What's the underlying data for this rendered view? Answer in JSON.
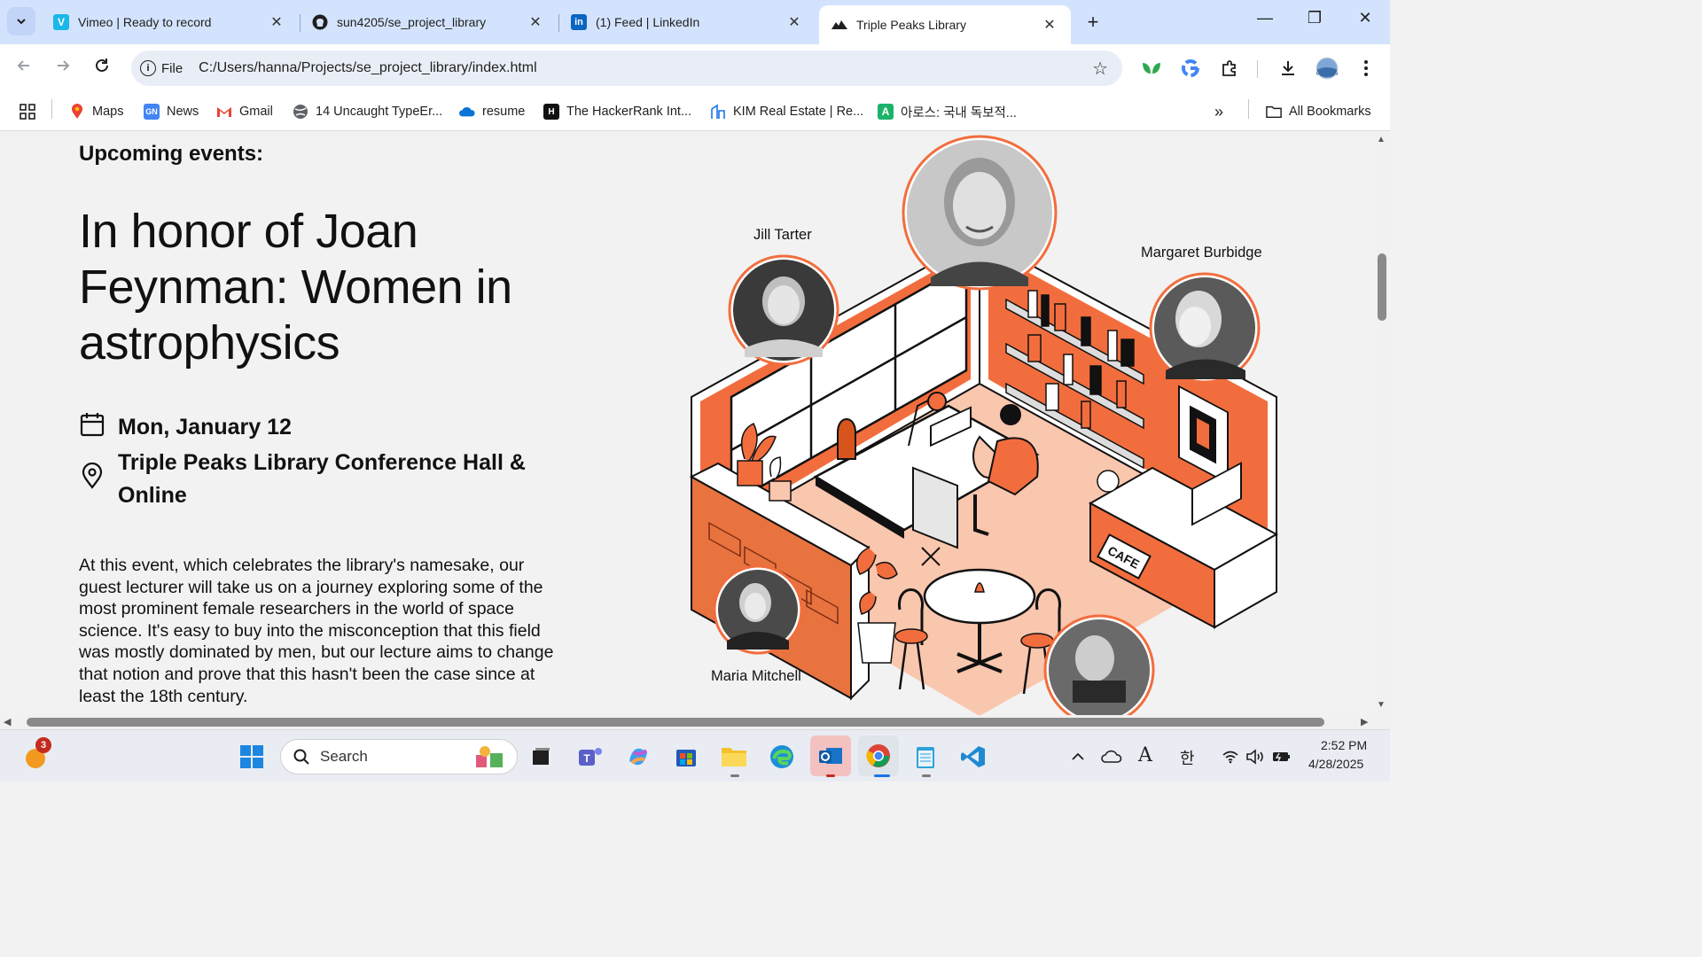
{
  "browser": {
    "tabs": [
      {
        "title": "Vimeo | Ready to record",
        "icon": "vimeo-icon",
        "color": "#1ab7ea",
        "glyph": "V"
      },
      {
        "title": "sun4205/se_project_library",
        "icon": "github-icon",
        "color": "#1f1f1f",
        "glyph": ""
      },
      {
        "title": "(1) Feed | LinkedIn",
        "icon": "linkedin-icon",
        "color": "#0a66c2",
        "glyph": "in"
      },
      {
        "title": "Triple Peaks Library",
        "icon": "mountain-icon",
        "color": "#1f1f1f",
        "glyph": ""
      }
    ],
    "active_tab": 3,
    "address": {
      "chip": "File",
      "url": "C:/Users/hanna/Projects/se_project_library/index.html"
    },
    "bookmarks": [
      {
        "label": "Maps",
        "icon": "maps-icon"
      },
      {
        "label": "News",
        "icon": "news-icon"
      },
      {
        "label": "Gmail",
        "icon": "gmail-icon"
      },
      {
        "label": "14 Uncaught TypeEr...",
        "icon": "globe-icon"
      },
      {
        "label": "resume",
        "icon": "onedrive-icon"
      },
      {
        "label": "The HackerRank Int...",
        "icon": "hackerrank-icon",
        "glyph": "H"
      },
      {
        "label": "KIM Real Estate | Re...",
        "icon": "building-icon"
      },
      {
        "label": "아로스: 국내 독보적...",
        "icon": "arose-icon",
        "glyph": "A"
      }
    ],
    "all_bookmarks": "All Bookmarks"
  },
  "page": {
    "upcoming": "Upcoming events:",
    "title": "In honor of Joan Feynman: Women in astrophysics",
    "date": "Mon, January 12",
    "location": "Triple Peaks Library Conference Hall & Online",
    "description": "At this event, which celebrates the library's namesake, our guest lecturer will take us on a journey exploring some of the most prominent female researchers in the world of space science. It's easy to buy into the misconception that this field was mostly dominated by men, but our lecture aims to change that notion and prove that this hasn't been the case since at least the 18th century.",
    "illustration": {
      "people": [
        "Jill Tarter",
        "Margaret Burbidge",
        "Maria Mitchell"
      ],
      "cafe_sign": "CAFE",
      "accent": "#f26d3d",
      "light_accent": "#f9c6ae"
    }
  },
  "taskbar": {
    "search_placeholder": "Search",
    "notification_count": "3",
    "time": "2:52 PM",
    "date": "4/28/2025",
    "ime": "한",
    "font_indicator": "A"
  }
}
